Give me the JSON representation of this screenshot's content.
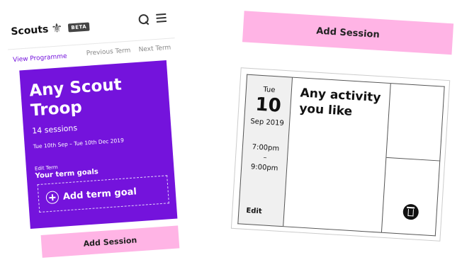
{
  "left_screen": {
    "brand": "Scouts",
    "beta_badge": "BETA",
    "icons": [
      "fleur-de-lis-icon",
      "search-icon",
      "menu-icon"
    ],
    "tabs": {
      "view_programme": "View Programme",
      "previous_term": "Previous Term",
      "next_term": "Next Term"
    },
    "term": {
      "title": "Any Scout Troop",
      "sessions": "14 sessions",
      "dates": "Tue 10th Sep – Tue 10th Dec 2019",
      "edit_term": "Edit Term",
      "goals_label": "Your term goals",
      "add_goal": "Add term goal"
    },
    "add_session": "Add Session"
  },
  "right_screen": {
    "add_session": "Add Session",
    "session": {
      "day_of_week": "Tue",
      "day": "10",
      "month_year": "Sep 2019",
      "start_time": "7:00pm",
      "dash": "–",
      "end_time": "9:00pm",
      "edit": "Edit",
      "activity": "Any activity you like"
    }
  },
  "colors": {
    "purple": "#7413dc",
    "pink": "#ffb4e5"
  }
}
